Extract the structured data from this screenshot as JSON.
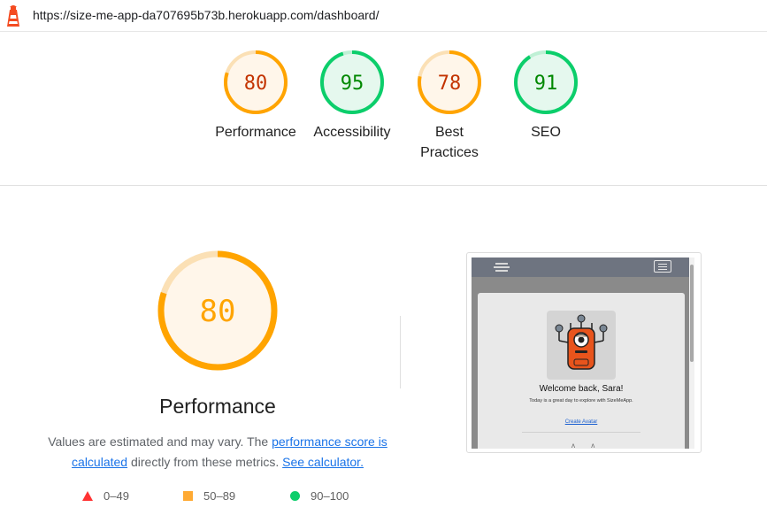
{
  "browser": {
    "url": "https://size-me-app-da707695b73b.herokuapp.com/dashboard/"
  },
  "colors": {
    "average": "#ffa400",
    "pass": "#0cce6b",
    "fail": "#ff3333",
    "average_text": "#c33300",
    "pass_text": "#008800"
  },
  "scores": [
    {
      "value": "80",
      "label": "Performance",
      "status": "average",
      "fraction": 0.8
    },
    {
      "value": "95",
      "label": "Accessibility",
      "status": "pass",
      "fraction": 0.95
    },
    {
      "value": "78",
      "label": "Best Practices",
      "status": "average",
      "fraction": 0.78
    },
    {
      "value": "91",
      "label": "SEO",
      "status": "pass",
      "fraction": 0.91
    }
  ],
  "performance": {
    "score": "80",
    "fraction": 0.8,
    "title": "Performance",
    "desc_pre": "Values are estimated and may vary. The ",
    "link_score": "performance score is calculated",
    "desc_mid": " directly from these metrics. ",
    "link_calc": "See calculator."
  },
  "legend": [
    {
      "range": "0–49",
      "shape": "triangle"
    },
    {
      "range": "50–89",
      "shape": "square"
    },
    {
      "range": "90–100",
      "shape": "circle"
    }
  ],
  "screenshot": {
    "welcome": "Welcome back, Sara!",
    "subtitle": "Today is a great day to explore with SizeMeApp.",
    "link": "Create Avatar",
    "bits": "ʌ ʌ"
  }
}
